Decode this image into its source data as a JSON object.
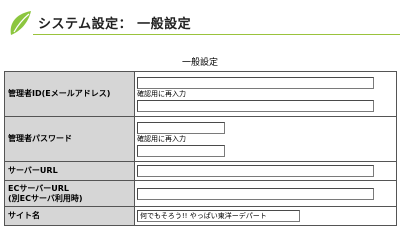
{
  "header": {
    "title": "システム設定： 一般設定",
    "logo_color": "#8cc63f",
    "accent_line_color": "#9ac33c"
  },
  "section": {
    "title": "一般設定"
  },
  "form": {
    "admin_id_label": "管理者ID(Eメールアドレス)",
    "admin_id_value": "",
    "admin_id_confirm_label": "確認用に再入力",
    "admin_id_confirm_value": "",
    "password_label": "管理者パスワード",
    "password_value": "",
    "password_confirm_label": "確認用に再入力",
    "password_confirm_value": "",
    "server_url_label": "サーバーURL",
    "server_url_value": "",
    "ec_server_url_label_line1": "ECサーバーURL",
    "ec_server_url_label_line2": "(別ECサーバ利用時)",
    "ec_server_url_value": "",
    "site_name_label": "サイト名",
    "site_name_value": "何でもそろう!! やっぱい東洋ーデパート"
  }
}
